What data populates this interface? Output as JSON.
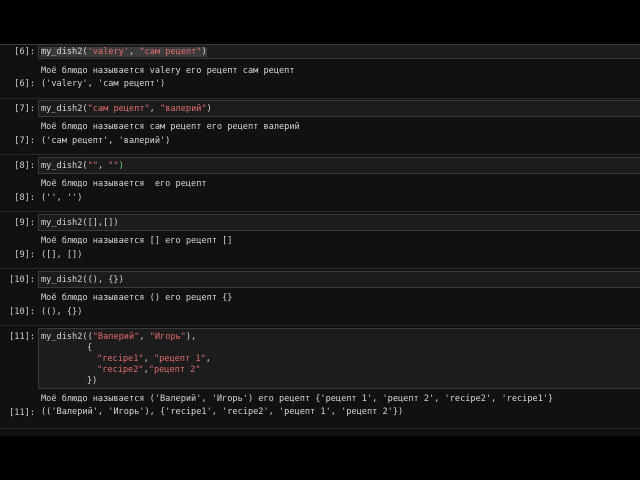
{
  "cells": [
    {
      "in_prompt": "[6]:",
      "out_prompt": "[6]:",
      "code": {
        "fn": "my_dish2(",
        "a1": "'valery'",
        "comma": ", ",
        "a2": "\"сам рецепт\"",
        "close": ")"
      },
      "stdout": "Моё блюдо называется valery его рецепт сам рецепт",
      "result": "('valery', 'сам рецепт')"
    },
    {
      "in_prompt": "[7]:",
      "out_prompt": "[7]:",
      "code": {
        "fn": "my_dish2(",
        "a1": "\"сам рецепт\"",
        "comma": ", ",
        "a2": "\"валерий\"",
        "close": ")"
      },
      "stdout": "Моё блюдо называется сам рецепт его рецепт валерий",
      "result": "('сам рецепт', 'валерий')"
    },
    {
      "in_prompt": "[8]:",
      "out_prompt": "[8]:",
      "code": {
        "fn": "my_dish2(",
        "a1": "\"\"",
        "comma": ", ",
        "a2": "\"\"",
        "close": ")"
      },
      "stdout": "Моё блюдо называется  его рецепт",
      "result": "('', '')"
    },
    {
      "in_prompt": "[9]:",
      "out_prompt": "[9]:",
      "code": {
        "text": "my_dish2([],[])"
      },
      "stdout": "Моё блюдо называется [] его рецепт []",
      "result": "([], [])"
    },
    {
      "in_prompt": "[10]:",
      "out_prompt": "[10]:",
      "code": {
        "text": "my_dish2((), {})"
      },
      "stdout": "Моё блюдо называется () его рецепт {}",
      "result": "((), {})"
    },
    {
      "in_prompt": "[11]:",
      "out_prompt": "[11]:",
      "code": {
        "l1a": "my_dish2((",
        "l1b": "\"Валерий\"",
        "l1c": ", ",
        "l1d": "\"Игорь\"",
        "l1e": "),",
        "l2": "{",
        "l3a": "\"recipe1\"",
        "l3b": ", ",
        "l3c": "\"рецепт 1\"",
        "l3d": ",",
        "l4a": "\"recipe2\"",
        "l4b": ",",
        "l4c": "\"рецепт 2\"",
        "l5": "})"
      },
      "stdout": "Моё блюдо называется ('Валерий', 'Игорь') его рецепт {'рецепт 1', 'рецепт 2', 'recipe2', 'recipe1'}",
      "result": "(('Валерий', 'Игорь'), {'recipe1', 'recipe2', 'рецепт 1', 'рецепт 2'})"
    }
  ]
}
